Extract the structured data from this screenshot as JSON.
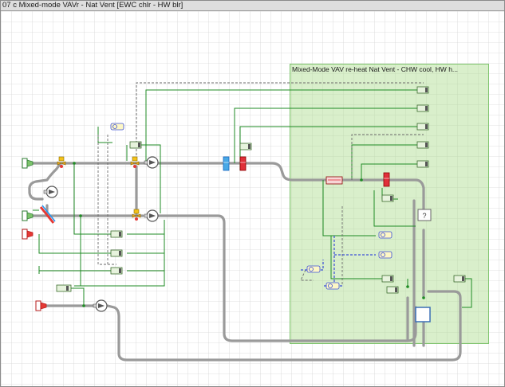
{
  "window": {
    "title": "07 c Mixed-mode VAVr - Nat Vent [EWC chlr - HW blr]"
  },
  "group": {
    "title": "Mixed-Mode VAV re-heat  Nat Vent - CHW cool, HW h..."
  },
  "diagram": {
    "question_mark": "?"
  },
  "colors": {
    "duct": "#9a9a9a",
    "control_wire": "#1f8b24",
    "sensor_wire": "#3b4fd8",
    "group_fill": "#cfe9bd",
    "heating_coil": "#e0303a",
    "cooling_coil": "#49a9e6"
  },
  "icons": [
    "fresh-air-inlet-icon",
    "exhaust-outlet-icon",
    "fan-icon",
    "damper-icon",
    "heat-recovery-icon",
    "cooling-coil-icon",
    "heating-coil-icon",
    "humidifier-icon",
    "controller-icon",
    "sensor-icon",
    "room-zone-icon",
    "junction-icon"
  ]
}
